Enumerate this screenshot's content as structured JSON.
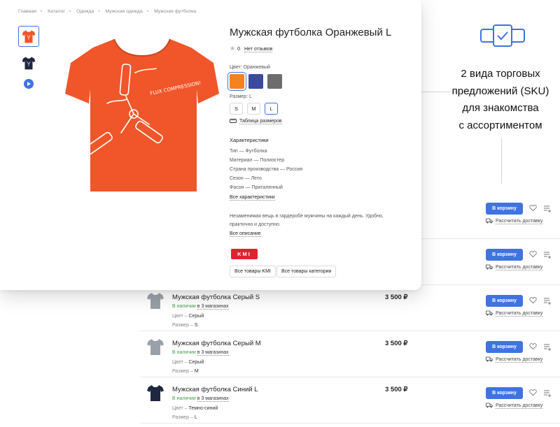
{
  "breadcrumbs": [
    "Главная",
    "Каталог",
    "Одежда",
    "Мужская одежда",
    "Мужская футболка"
  ],
  "product": {
    "title": "Мужская футболка Оранжевый L",
    "rating_count": "0",
    "reviews_link": "Нет отзывов",
    "color_label": "Цвет: Оранжевый",
    "colors": [
      {
        "name": "orange",
        "hex": "#f58220",
        "selected": true
      },
      {
        "name": "blue",
        "hex": "#3b4a9a",
        "selected": false
      },
      {
        "name": "gray",
        "hex": "#6d6d6d",
        "selected": false
      }
    ],
    "size_label": "Размер: L",
    "sizes": [
      {
        "label": "S",
        "selected": false
      },
      {
        "label": "M",
        "selected": false
      },
      {
        "label": "L",
        "selected": true
      }
    ],
    "size_table_link": "Таблица размеров",
    "characteristics_title": "Характеристики",
    "characteristics": [
      "Тип — Футболка",
      "Материал — Полиэстер",
      "Страна производства — Россия",
      "Сезон — Лето",
      "Фасон — Приталенный"
    ],
    "all_characteristics_link": "Все характеристики",
    "description": "Незаменимая вещь в гардеробе мужчины на каждый день. Удобно, практично и доступно.",
    "all_description_link": "Все описание",
    "brand_logo_text": "KMI",
    "brand_button": "Все товары KMI",
    "category_button": "Все товары категории",
    "shirt_print_text": "FLUX COMPRESSION!"
  },
  "promo": {
    "lines": [
      "2 вида торговых",
      "предложений (SKU)",
      "для знакомства",
      "с ассортиментом"
    ],
    "accent": "#3f73e0"
  },
  "offers": [
    {
      "name": "",
      "stock": "",
      "stock_link": "",
      "color_label": "",
      "color_value": "",
      "size_label": "",
      "size_value": "",
      "price": "",
      "cart": "В корзину",
      "delivery": "Рассчитать доставку",
      "thumb_color": ""
    },
    {
      "name": "",
      "stock": "",
      "stock_link": "",
      "color_label": "",
      "color_value": "",
      "size_label": "",
      "size_value": "",
      "price": "",
      "cart": "В корзину",
      "delivery": "Рассчитать доставку",
      "thumb_color": ""
    },
    {
      "name": "Мужская футболка Серый S",
      "stock": "В наличии",
      "stock_link": "в 3 магазинах",
      "color_label": "Цвет – ",
      "color_value": "Серый",
      "size_label": "Размер – ",
      "size_value": "S",
      "price": "3 500 ₽",
      "cart": "В корзину",
      "delivery": "Рассчитать доставку",
      "thumb_color": "#9aa0a8"
    },
    {
      "name": "Мужская футболка Серый M",
      "stock": "В наличии",
      "stock_link": "в 3 магазинах",
      "color_label": "Цвет – ",
      "color_value": "Серый",
      "size_label": "Размер – ",
      "size_value": "M",
      "price": "3 500 ₽",
      "cart": "В корзину",
      "delivery": "Рассчитать доставку",
      "thumb_color": "#9aa0a8"
    },
    {
      "name": "Мужская футболка Синий L",
      "stock": "В наличии",
      "stock_link": "в 3 магазинах",
      "color_label": "Цвет – ",
      "color_value": "Темно-синий",
      "size_label": "Размер – ",
      "size_value": "L",
      "price": "3 500 ₽",
      "cart": "В корзину",
      "delivery": "Рассчитать доставку",
      "thumb_color": "#1f2740"
    }
  ]
}
